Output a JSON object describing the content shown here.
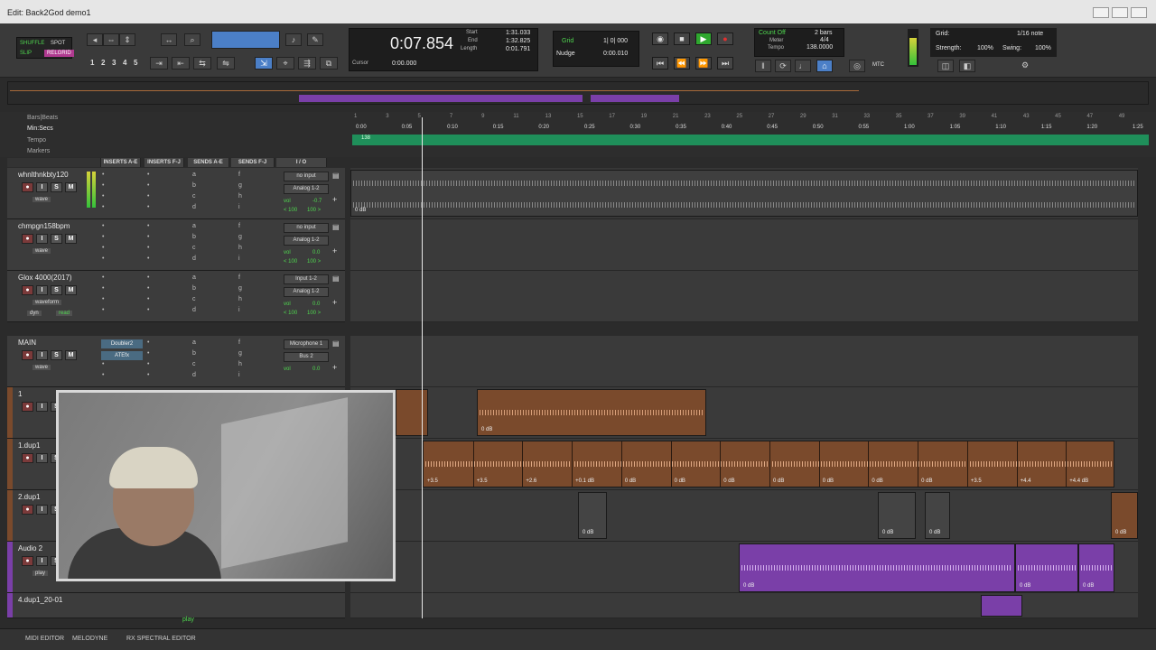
{
  "window": {
    "title": "Edit: Back2God demo1"
  },
  "modes": {
    "shuffle": "SHUFFLE",
    "spot": "SPOT",
    "slip": "SLIP",
    "grid": "RELGRID"
  },
  "zoom_presets": [
    "1",
    "2",
    "3",
    "4",
    "5"
  ],
  "counter": {
    "main": "0:07.854",
    "start_label": "Start",
    "start": "1:31.033",
    "end_label": "End",
    "end": "1:32.825",
    "length_label": "Length",
    "length": "0:01.791",
    "cursor_label": "Cursor",
    "cursor": "0:00.000"
  },
  "grid": {
    "grid_label": "Grid",
    "grid_value": "1| 0| 000",
    "nudge_label": "Nudge",
    "nudge_value": "0:00.010"
  },
  "count": {
    "count_off": "Count Off",
    "bars": "2 bars",
    "meter_label": "Meter",
    "meter": "4/4",
    "tempo_label": "Tempo",
    "tempo": "138.0000"
  },
  "mtc": "MTC",
  "quantize": {
    "grid_label": "Grid:",
    "note": "1/16 note",
    "strength_label": "Strength:",
    "strength": "100%",
    "swing_label": "Swing:",
    "swing": "100%"
  },
  "rulers": {
    "bars_beats": "Bars|Beats",
    "min_secs": "Min:Secs",
    "tempo": "Tempo",
    "markers": "Markers",
    "bars": [
      "1",
      "3",
      "5",
      "7",
      "9",
      "11",
      "13",
      "15",
      "17",
      "19",
      "21",
      "23",
      "25",
      "27",
      "29",
      "31",
      "33",
      "35",
      "37",
      "39",
      "41",
      "43",
      "45",
      "47",
      "49"
    ],
    "secs": [
      "0:00",
      "0:05",
      "0:10",
      "0:15",
      "0:20",
      "0:25",
      "0:30",
      "0:35",
      "0:40",
      "0:45",
      "0:50",
      "0:55",
      "1:00",
      "1:05",
      "1:10",
      "1:15",
      "1:20",
      "1:25"
    ],
    "tempo_value": "138"
  },
  "columns": {
    "inserts_ae": "INSERTS A-E",
    "inserts_fj": "INSERTS F-J",
    "sends_ae": "SENDS A-E",
    "sends_fj": "SENDS F-J",
    "io": "I / O"
  },
  "tracks": [
    {
      "name": "whnlthnkbty120",
      "input": "no input",
      "output": "Analog 1-2",
      "vol_label": "vol",
      "vol": "-0.7",
      "pan_l": "< 100",
      "pan_r": "100 >",
      "view": "wave",
      "clip_db": "0 dB"
    },
    {
      "name": "chmpgn158bpm",
      "input": "no input",
      "output": "Analog 1-2",
      "vol_label": "vol",
      "vol": "0.0",
      "pan_l": "< 100",
      "pan_r": "100 >",
      "view": "wave"
    },
    {
      "name": "Glox 4000(2017)",
      "input": "Input 1-2",
      "output": "Analog 1-2",
      "vol_label": "vol",
      "vol": "0.0",
      "pan_l": "< 100",
      "pan_r": "100 >",
      "view": "waveform",
      "auto": "dyn",
      "auto2": "read"
    },
    {
      "name": "MAIN",
      "insert1": "Doubler2",
      "insert2": "ATEfx",
      "input": "Microphone 1",
      "output": "Bus 2",
      "vol_label": "vol",
      "vol": "0.0",
      "view": "wave"
    },
    {
      "name": "1"
    },
    {
      "name": "1.dup1"
    },
    {
      "name": "2.dup1"
    },
    {
      "name": "Audio 2",
      "view": "play"
    },
    {
      "name": "4.dup1_20-01"
    }
  ],
  "buttons": {
    "solo": "S",
    "mute": "M",
    "input": "I"
  },
  "sends_letters": [
    "a",
    "b",
    "c",
    "d",
    "f",
    "g",
    "h",
    "i",
    "j"
  ],
  "clips": {
    "orange_row1": "0 dB",
    "orange_row2": [
      "+3.5",
      "+3.5",
      "+2.6",
      "+0.1 dB",
      "0 dB",
      "0 dB",
      "0 dB",
      "0 dB",
      "0 dB",
      "0 dB",
      "0 dB",
      "+3.5",
      "+4.4",
      "+4.4 dB"
    ],
    "gray_row": [
      "0 dB",
      "0 dB",
      "0 dB",
      "0 dB"
    ],
    "purple_row": [
      "0 dB",
      "0 dB",
      "0 dB"
    ]
  },
  "status_play": "play",
  "bottom": {
    "midi": "MIDI EDITOR",
    "melodyne": "MELODYNE",
    "rx": "RX SPECTRAL EDITOR"
  },
  "colors": {
    "orange_clip": "#7a4a2c",
    "purple_clip": "#7a3fa8",
    "tempo_green": "#1f8f5a",
    "accent_blue": "#4b7fc7"
  }
}
